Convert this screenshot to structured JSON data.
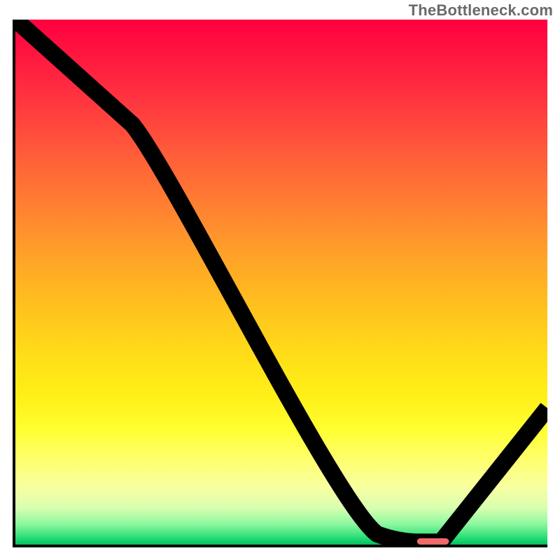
{
  "watermark": "TheBottleneck.com",
  "chart_data": {
    "type": "line",
    "title": "",
    "xlabel": "",
    "ylabel": "",
    "xlim": [
      0,
      100
    ],
    "ylim": [
      0,
      100
    ],
    "legend": false,
    "grid": false,
    "series": [
      {
        "name": "bottleneck-curve",
        "x": [
          0.0,
          22.0,
          68.0,
          76.0,
          80.0,
          100.0
        ],
        "values": [
          100.0,
          80.0,
          2.0,
          0.5,
          0.5,
          26.0
        ]
      }
    ],
    "marker": {
      "name": "highlight",
      "x_start": 75.5,
      "x_end": 81.5,
      "y": 0.6,
      "color": "#ee6a6b"
    },
    "gradient_stops": [
      {
        "pos": 0,
        "color": "#ff0040"
      },
      {
        "pos": 25,
        "color": "#ff5a3a"
      },
      {
        "pos": 50,
        "color": "#ffb024"
      },
      {
        "pos": 78,
        "color": "#ffff30"
      },
      {
        "pos": 93,
        "color": "#d8ffb0"
      },
      {
        "pos": 100,
        "color": "#00c060"
      }
    ]
  }
}
